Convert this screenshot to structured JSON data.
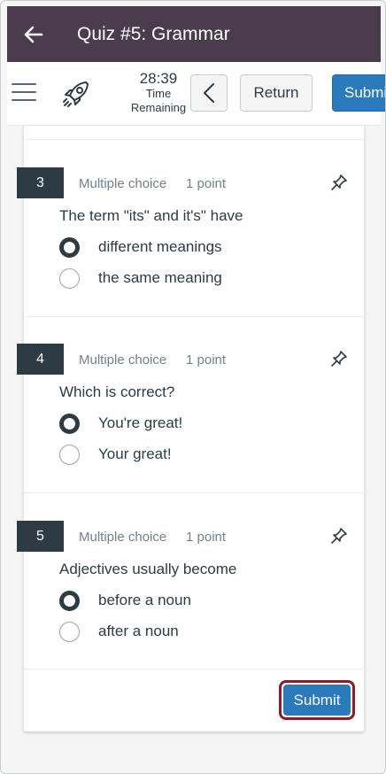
{
  "header": {
    "title": "Quiz #5: Grammar"
  },
  "toolbar": {
    "time": "28:39",
    "time_label_line1": "Time",
    "time_label_line2": "Remaining",
    "return_label": "Return",
    "submit_label": "Submit"
  },
  "questions": [
    {
      "number": "3",
      "type": "Multiple choice",
      "points": "1 point",
      "text": "The term \"its\" and it's\" have",
      "options": [
        {
          "label": "different meanings",
          "selected": true
        },
        {
          "label": "the same meaning",
          "selected": false
        }
      ]
    },
    {
      "number": "4",
      "type": "Multiple choice",
      "points": "1 point",
      "text": "Which is correct?",
      "options": [
        {
          "label": "You're great!",
          "selected": true
        },
        {
          "label": "Your great!",
          "selected": false
        }
      ]
    },
    {
      "number": "5",
      "type": "Multiple choice",
      "points": "1 point",
      "text": "Adjectives usually become",
      "options": [
        {
          "label": "before a noun",
          "selected": true
        },
        {
          "label": "after a noun",
          "selected": false
        }
      ]
    }
  ],
  "footer": {
    "submit_label": "Submit"
  },
  "colors": {
    "title_bar": "#4a3c4c",
    "primary_button": "#2b7abc",
    "question_number_bg": "#2d3b45",
    "highlight_outline": "#8a1c2b"
  }
}
